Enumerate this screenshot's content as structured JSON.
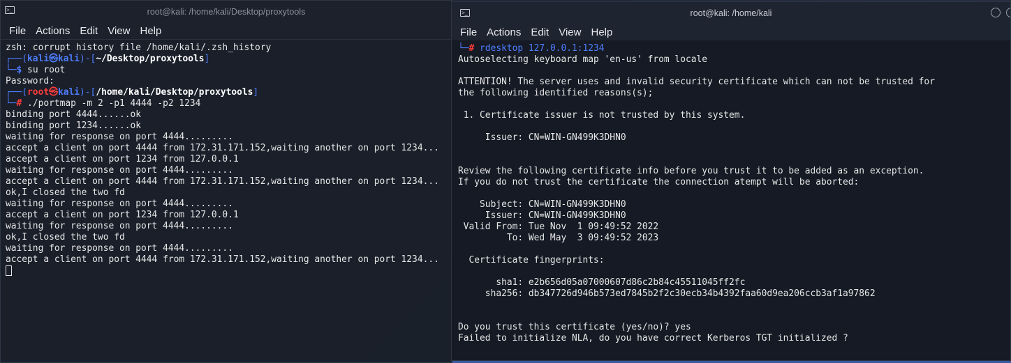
{
  "left_window": {
    "title": "root@kali: /home/kali/Desktop/proxytools",
    "menu": [
      "File",
      "Actions",
      "Edit",
      "View",
      "Help"
    ],
    "lines": [
      "zsh: corrupt history file /home/kali/.zsh_history",
      "binding port 4444......ok",
      "binding port 1234......ok",
      "waiting for response on port 4444.........",
      "accept a client on port 4444 from 172.31.171.152,waiting another on port 1234...",
      "accept a client on port 1234 from 127.0.0.1",
      "waiting for response on port 4444.........",
      "accept a client on port 4444 from 172.31.171.152,waiting another on port 1234...",
      "ok,I closed the two fd",
      "waiting for response on port 4444.........",
      "accept a client on port 1234 from 127.0.0.1",
      "waiting for response on port 4444.........",
      "ok,I closed the two fd",
      "waiting for response on port 4444.........",
      "accept a client on port 4444 from 172.31.171.152,waiting another on port 1234..."
    ],
    "prompt1": {
      "open": "┌──(",
      "user": "kali",
      "at": "㉿",
      "host": "kali",
      "mid": ")-[",
      "path": "~/Desktop/proxytools",
      "close": "]",
      "arrow": "└─",
      "sym": "$",
      "cmd": " su root"
    },
    "password_line": "Password:",
    "prompt2": {
      "open": "┌──(",
      "user": "root",
      "at": "㉿",
      "host": "kali",
      "mid": ")-[",
      "path": "/home/kali/Desktop/proxytools",
      "close": "]",
      "arrow": "└─",
      "sym": "#",
      "cmd": " ./portmap -m 2 -p1 4444 -p2 1234"
    }
  },
  "right_window": {
    "title": "root@kali: /home/kali",
    "menu": [
      "File",
      "Actions",
      "Edit",
      "View",
      "Help"
    ],
    "prompt": {
      "arrow": "└─",
      "sym": "#",
      "cmd": " rdesktop 127.0.0.1:1234"
    },
    "lines": [
      "Autoselecting keyboard map 'en-us' from locale",
      "",
      "ATTENTION! The server uses and invalid security certificate which can not be trusted for",
      "the following identified reasons(s);",
      "",
      " 1. Certificate issuer is not trusted by this system.",
      "",
      "     Issuer: CN=WIN-GN499K3DHN0",
      "",
      "",
      "Review the following certificate info before you trust it to be added as an exception.",
      "If you do not trust the certificate the connection atempt will be aborted:",
      "",
      "    Subject: CN=WIN-GN499K3DHN0",
      "     Issuer: CN=WIN-GN499K3DHN0",
      " Valid From: Tue Nov  1 09:49:52 2022",
      "         To: Wed May  3 09:49:52 2023",
      "",
      "  Certificate fingerprints:",
      "",
      "       sha1: e2b656d05a07000607d86c2b84c45511045ff2fc",
      "     sha256: db347726d946b573ed7845b2f2c30ecb34b4392faa60d9ea206ccb3af1a97862",
      "",
      "",
      "Do you trust this certificate (yes/no)? yes",
      "Failed to initialize NLA, do you have correct Kerberos TGT initialized ?"
    ]
  },
  "icons": {
    "terminal": "terminal-icon",
    "min": "minimize-icon",
    "max": "maximize-icon"
  }
}
